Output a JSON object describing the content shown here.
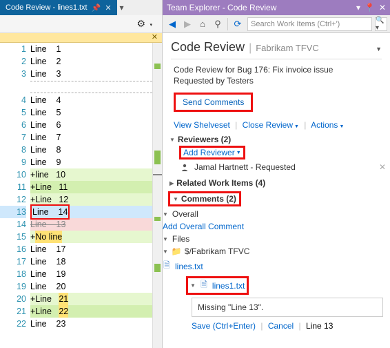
{
  "left": {
    "tab_title": "Code Review - lines1.txt",
    "lines": [
      {
        "n": 1,
        "t": "Line    1"
      },
      {
        "n": 2,
        "t": "Line    2"
      },
      {
        "n": 3,
        "t": "Line    3"
      },
      {
        "gap": true
      },
      {
        "n": 4,
        "t": "Line    4"
      },
      {
        "n": 5,
        "t": "Line    5"
      },
      {
        "n": 6,
        "t": "Line    6"
      },
      {
        "n": 7,
        "t": "Line    7"
      },
      {
        "n": 8,
        "t": "Line    8"
      },
      {
        "n": 9,
        "t": "Line    9"
      },
      {
        "n": 10,
        "t": "+line   10",
        "cls": "add"
      },
      {
        "n": 11,
        "t": "+Line   11",
        "cls": "addS"
      },
      {
        "n": 12,
        "t": "+Line   12",
        "cls": "add"
      },
      {
        "n": 13,
        "t": "Line    14",
        "cls": "sel hl"
      },
      {
        "n": 14,
        "t": "Line    13",
        "cls": "delS"
      },
      {
        "n": 15,
        "pre": "+",
        "mark": "No line",
        "cls": "add"
      },
      {
        "n": 16,
        "t": "Line    17"
      },
      {
        "n": 17,
        "t": "Line    18"
      },
      {
        "n": 18,
        "t": "Line    19"
      },
      {
        "n": 19,
        "t": "Line    20"
      },
      {
        "n": 20,
        "pre": "+Line   ",
        "mark": "21",
        "cls": "add"
      },
      {
        "n": 21,
        "pre": "+Line   ",
        "mark": "22",
        "cls": "addS"
      },
      {
        "n": 22,
        "t": "Line    23"
      }
    ]
  },
  "te": {
    "title": "Team Explorer - Code Review",
    "search_placeholder": "Search Work Items (Ctrl+')",
    "heading": "Code Review",
    "project": "Fabrikam TFVC",
    "desc": "Code Review for Bug 176: Fix invoice issue",
    "requested": "Requested by Testers",
    "send_btn": "Send Comments",
    "links": {
      "view": "View Shelveset",
      "close": "Close Review",
      "actions": "Actions"
    },
    "reviewers_h": "Reviewers (2)",
    "add_reviewer": "Add Reviewer",
    "reviewer_name": "Jamal Hartnett - Requested",
    "related_h": "Related Work Items (4)",
    "comments_h": "Comments (2)",
    "overall": "Overall",
    "add_overall": "Add Overall Comment",
    "files_h": "Files",
    "folder": "$/Fabrikam TFVC",
    "file1": "lines.txt",
    "file2": "lines1.txt",
    "comment_text": "Missing \"Line 13\".",
    "save": "Save (Ctrl+Enter)",
    "cancel": "Cancel",
    "status_line": "Line 13"
  }
}
